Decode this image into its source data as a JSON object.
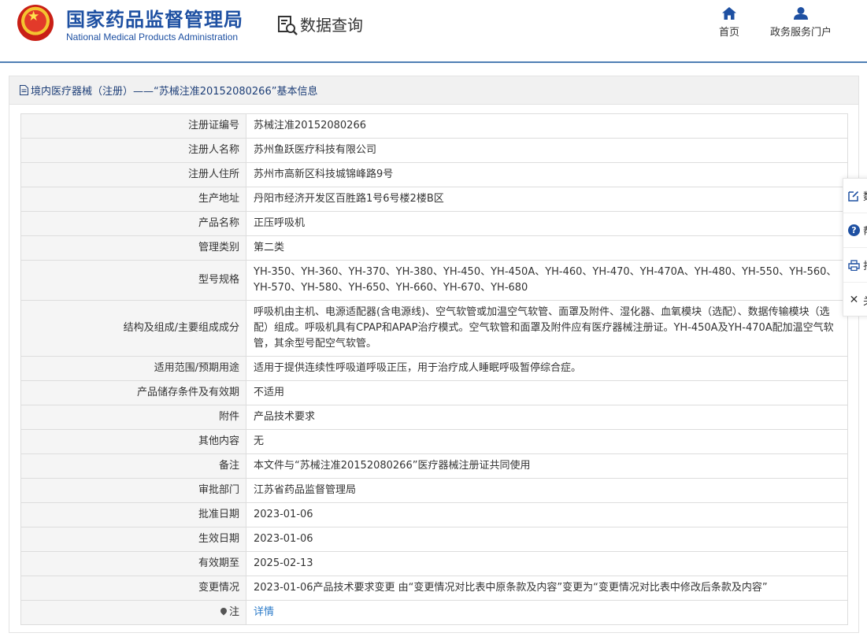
{
  "header": {
    "org_name_cn": "国家药品监督管理局",
    "org_name_en": "National Medical Products Administration",
    "section_title": "数据查询",
    "nav": [
      {
        "label": "首页",
        "icon": "home-icon"
      },
      {
        "label": "政务服务门户",
        "icon": "user-icon"
      }
    ]
  },
  "panel": {
    "title": "境内医疗器械（注册）——“苏械注准20152080266”基本信息",
    "rows": [
      {
        "label": "注册证编号",
        "value": "苏械注准20152080266"
      },
      {
        "label": "注册人名称",
        "value": "苏州鱼跃医疗科技有限公司"
      },
      {
        "label": "注册人住所",
        "value": "苏州市高新区科技城锦峰路9号"
      },
      {
        "label": "生产地址",
        "value": "丹阳市经济开发区百胜路1号6号楼2楼B区"
      },
      {
        "label": "产品名称",
        "value": "正压呼吸机"
      },
      {
        "label": "管理类别",
        "value": "第二类"
      },
      {
        "label": "型号规格",
        "value": "YH-350、YH-360、YH-370、YH-380、YH-450、YH-450A、YH-460、YH-470、YH-470A、YH-480、YH-550、YH-560、YH-570、YH-580、YH-650、YH-660、YH-670、YH-680"
      },
      {
        "label": "结构及组成/主要组成成分",
        "value": "呼吸机由主机、电源适配器(含电源线)、空气软管或加温空气软管、面罩及附件、湿化器、血氧模块（选配）、数据传输模块（选配）组成。呼吸机具有CPAP和APAP治疗模式。空气软管和面罩及附件应有医疗器械注册证。YH-450A及YH-470A配加温空气软管，其余型号配空气软管。"
      },
      {
        "label": "适用范围/预期用途",
        "value": "适用于提供连续性呼吸道呼吸正压，用于治疗成人睡眠呼吸暂停综合症。"
      },
      {
        "label": "产品储存条件及有效期",
        "value": "不适用"
      },
      {
        "label": "附件",
        "value": "产品技术要求"
      },
      {
        "label": "其他内容",
        "value": "无"
      },
      {
        "label": "备注",
        "value": "本文件与“苏械注准20152080266”医疗器械注册证共同使用"
      },
      {
        "label": "审批部门",
        "value": "江苏省药品监督管理局"
      },
      {
        "label": "批准日期",
        "value": "2023-01-06"
      },
      {
        "label": "生效日期",
        "value": "2023-01-06"
      },
      {
        "label": "有效期至",
        "value": "2025-02-13"
      },
      {
        "label": "变更情况",
        "value": "2023-01-06产品技术要求变更 由“变更情况对比表中原条款及内容”变更为“变更情况对比表中修改后条款及内容”"
      }
    ],
    "note_row": {
      "label": "注",
      "link_text": "详情"
    }
  },
  "float_bar": {
    "items": [
      {
        "label": "数",
        "icon": "edit-icon"
      },
      {
        "label": "帮",
        "icon": "help-icon"
      },
      {
        "label": "打",
        "icon": "print-icon"
      },
      {
        "label": "关",
        "icon": "close-icon"
      }
    ]
  },
  "colors": {
    "brand": "#1e50a2",
    "link": "#2b7bc9",
    "label_bg": "#f5f5f5",
    "header_rule": "#4f7fb4"
  }
}
